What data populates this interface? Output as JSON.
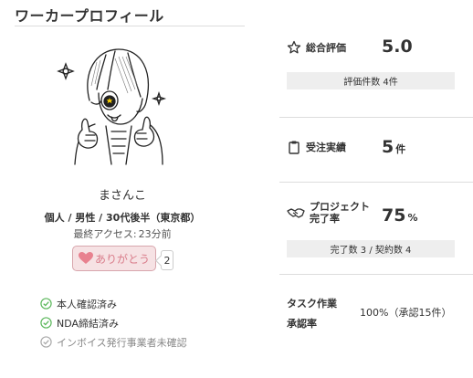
{
  "header": {
    "title": "ワーカープロフィール"
  },
  "user": {
    "name": "まさんこ",
    "attributes": "個人 / 男性 / 30代後半（東京都）",
    "last_access_label": "最終アクセス:",
    "last_access_value": "23分前"
  },
  "thanks": {
    "label": "ありがとう",
    "count": "2",
    "color": "#d97c8a"
  },
  "verifications": [
    {
      "label": "本人確認済み",
      "status": "verified"
    },
    {
      "label": "NDA締結済み",
      "status": "verified"
    },
    {
      "label": "インボイス発行事業者未確認",
      "status": "unverified"
    }
  ],
  "stats": {
    "rating": {
      "label": "総合評価",
      "value": "5.0",
      "sub": "評価件数 4件",
      "icon": "star-icon"
    },
    "orders": {
      "label": "受注実績",
      "value": "5",
      "unit": "件",
      "icon": "clipboard-icon"
    },
    "completion": {
      "label_line1": "プロジェクト",
      "label_line2": "完了率",
      "value": "75",
      "unit": "%",
      "sub": "完了数 3 / 契約数 4",
      "icon": "handshake-icon"
    },
    "approval": {
      "label_line1": "タスク作業",
      "label_line2": "承認率",
      "value": "100%（承認15件）"
    }
  },
  "colors": {
    "verified": "#5cb85c",
    "unverified": "#aaaaaa",
    "band": "#eeeeee"
  }
}
